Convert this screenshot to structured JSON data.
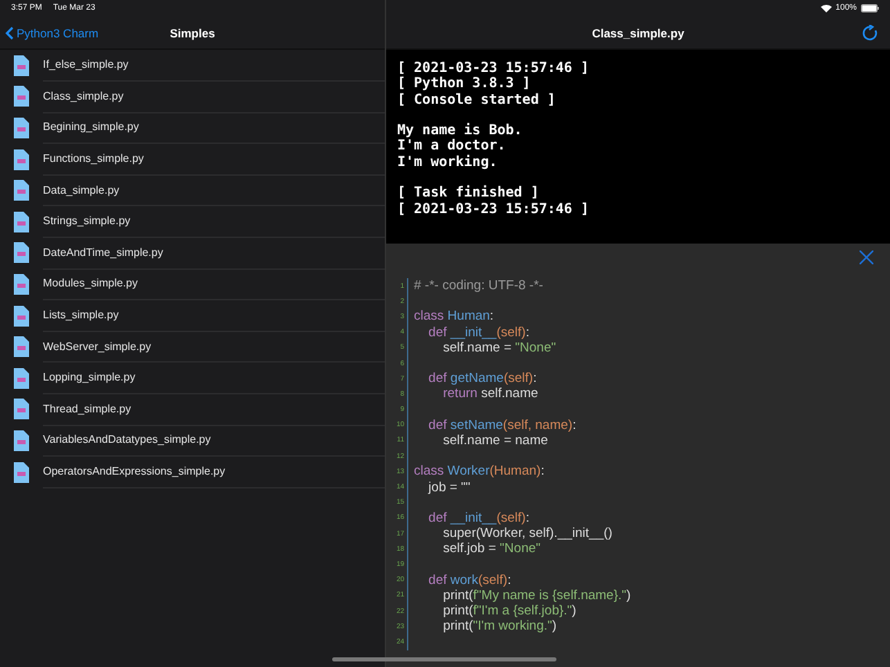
{
  "status_bar": {
    "time": "3:57 PM",
    "date": "Tue Mar 23",
    "battery": "100%"
  },
  "sidebar": {
    "back": "Python3 Charm",
    "title": "Simples",
    "items": [
      {
        "label": "If_else_simple.py"
      },
      {
        "label": "Class_simple.py"
      },
      {
        "label": "Begining_simple.py"
      },
      {
        "label": "Functions_simple.py"
      },
      {
        "label": "Data_simple.py"
      },
      {
        "label": "Strings_simple.py"
      },
      {
        "label": "DateAndTime_simple.py"
      },
      {
        "label": "Modules_simple.py"
      },
      {
        "label": "Lists_simple.py"
      },
      {
        "label": "WebServer_simple.py"
      },
      {
        "label": "Lopping_simple.py"
      },
      {
        "label": "Thread_simple.py"
      },
      {
        "label": "VariablesAndDatatypes_simple.py"
      },
      {
        "label": "OperatorsAndExpressions_simple.py"
      }
    ]
  },
  "detail": {
    "title": "Class_simple.py",
    "console": [
      [
        "[ 2021-03-23 15:57:46 ]",
        "[ Python 3.8.3 ]",
        "[ Console started ]"
      ],
      [
        "My name is Bob.",
        "I'm a doctor.",
        "I'm working."
      ],
      [
        "[ Task finished ]",
        "[ 2021-03-23 15:57:46 ]"
      ]
    ],
    "code": [
      {
        "number": "1",
        "tokens": [
          {
            "text": "# -*- coding: UTF-8 -*-",
            "kind": "comment"
          }
        ]
      },
      {
        "number": "2"
      },
      {
        "number": "3",
        "tokens": [
          {
            "text": "class ",
            "kind": "keyword"
          },
          {
            "text": "Human",
            "kind": "name"
          },
          {
            "text": ":",
            "kind": "plain"
          }
        ]
      },
      {
        "number": "4",
        "tokens": [
          {
            "text": "    def ",
            "kind": "keyword"
          },
          {
            "text": "__init__",
            "kind": "name"
          },
          {
            "text": "(self)",
            "kind": "param"
          },
          {
            "text": ":",
            "kind": "plain"
          }
        ]
      },
      {
        "number": "5",
        "tokens": [
          {
            "text": "        self.name = ",
            "kind": "plain"
          },
          {
            "text": "\"None\"",
            "kind": "string"
          }
        ]
      },
      {
        "number": "6"
      },
      {
        "number": "7",
        "tokens": [
          {
            "text": "    def ",
            "kind": "keyword"
          },
          {
            "text": "getName",
            "kind": "name"
          },
          {
            "text": "(self)",
            "kind": "param"
          },
          {
            "text": ":",
            "kind": "plain"
          }
        ]
      },
      {
        "number": "8",
        "tokens": [
          {
            "text": "        return ",
            "kind": "keyword"
          },
          {
            "text": "self.name",
            "kind": "plain"
          }
        ]
      },
      {
        "number": "9"
      },
      {
        "number": "10",
        "tokens": [
          {
            "text": "    def ",
            "kind": "keyword"
          },
          {
            "text": "setName",
            "kind": "name"
          },
          {
            "text": "(self, name)",
            "kind": "param"
          },
          {
            "text": ":",
            "kind": "plain"
          }
        ]
      },
      {
        "number": "11",
        "tokens": [
          {
            "text": "        self.name = name",
            "kind": "plain"
          }
        ]
      },
      {
        "number": "12"
      },
      {
        "number": "13",
        "tokens": [
          {
            "text": "class ",
            "kind": "keyword"
          },
          {
            "text": "Worker",
            "kind": "name"
          },
          {
            "text": "(Human)",
            "kind": "param"
          },
          {
            "text": ":",
            "kind": "plain"
          }
        ]
      },
      {
        "number": "14",
        "tokens": [
          {
            "text": "    job = \"\"",
            "kind": "plain"
          }
        ]
      },
      {
        "number": "15"
      },
      {
        "number": "16",
        "tokens": [
          {
            "text": "    def ",
            "kind": "keyword"
          },
          {
            "text": "__init__",
            "kind": "name"
          },
          {
            "text": "(self)",
            "kind": "param"
          },
          {
            "text": ":",
            "kind": "plain"
          }
        ]
      },
      {
        "number": "17",
        "tokens": [
          {
            "text": "        super(Worker, self).__init__()",
            "kind": "plain"
          }
        ]
      },
      {
        "number": "18",
        "tokens": [
          {
            "text": "        self.job = ",
            "kind": "plain"
          },
          {
            "text": "\"None\"",
            "kind": "string"
          }
        ]
      },
      {
        "number": "19"
      },
      {
        "number": "20",
        "tokens": [
          {
            "text": "    def ",
            "kind": "keyword"
          },
          {
            "text": "work",
            "kind": "name"
          },
          {
            "text": "(self)",
            "kind": "param"
          },
          {
            "text": ":",
            "kind": "plain"
          }
        ]
      },
      {
        "number": "21",
        "tokens": [
          {
            "text": "        print(",
            "kind": "plain"
          },
          {
            "text": "f\"My name is {self.name}.\"",
            "kind": "string"
          },
          {
            "text": ")",
            "kind": "plain"
          }
        ]
      },
      {
        "number": "22",
        "tokens": [
          {
            "text": "        print(",
            "kind": "plain"
          },
          {
            "text": "f\"I'm a {self.job}.\"",
            "kind": "string"
          },
          {
            "text": ")",
            "kind": "plain"
          }
        ]
      },
      {
        "number": "23",
        "tokens": [
          {
            "text": "        print(",
            "kind": "plain"
          },
          {
            "text": "\"I'm working.\"",
            "kind": "string"
          },
          {
            "text": ")",
            "kind": "plain"
          }
        ]
      },
      {
        "number": "24"
      }
    ]
  }
}
